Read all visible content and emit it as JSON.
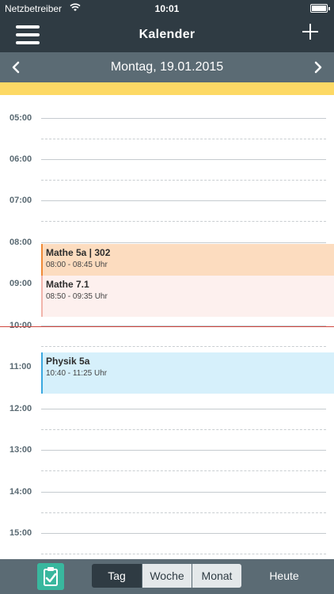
{
  "status_bar": {
    "carrier": "Netzbetreiber",
    "time": "10:01",
    "wifi_icon": "wifi-icon",
    "battery_icon": "battery-icon",
    "battery_level": 1.0
  },
  "nav": {
    "title": "Kalender",
    "menu_icon": "hamburger-menu-icon",
    "add_icon": "plus-icon"
  },
  "date_bar": {
    "date": "Montag, 19.01.2015",
    "prev_icon": "chevron-left-icon",
    "next_icon": "chevron-right-icon"
  },
  "timeline": {
    "hours": [
      "05:00",
      "06:00",
      "07:00",
      "08:00",
      "09:00",
      "10:00",
      "11:00",
      "12:00",
      "13:00",
      "14:00",
      "15:00"
    ],
    "current_time": "10:01"
  },
  "events": [
    {
      "title": "Mathe 5a | 302",
      "time": "08:00 - 08:45 Uhr",
      "color": "#f08a37"
    },
    {
      "title": "Mathe 7.1",
      "time": "08:50 - 09:35 Uhr",
      "color": "#f2b4ab"
    },
    {
      "title": "Physik 5a",
      "time": "10:40 - 11:25 Uhr",
      "color": "#3aa8e0"
    }
  ],
  "tab_bar": {
    "clipboard_icon": "clipboard-check-icon",
    "segments": [
      "Tag",
      "Woche",
      "Monat"
    ],
    "selected_segment": "Tag",
    "today_label": "Heute"
  },
  "colors": {
    "header": "#2f3b43",
    "bar": "#5b6b74",
    "allday": "#fdd965",
    "accent_green": "#39b79e",
    "now_line": "#d0473f"
  }
}
